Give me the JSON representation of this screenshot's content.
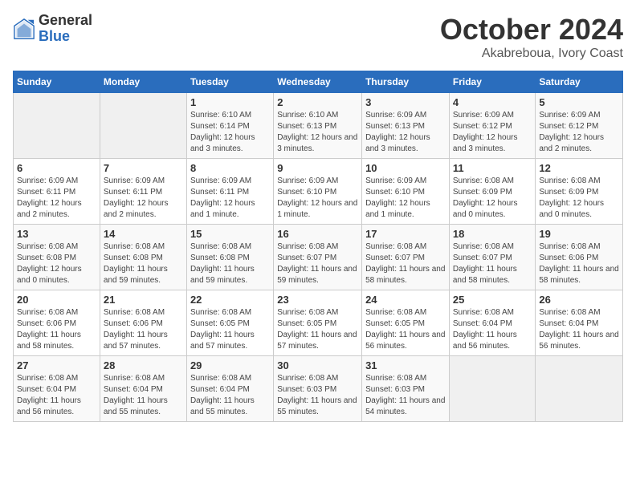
{
  "header": {
    "logo_general": "General",
    "logo_blue": "Blue",
    "month": "October 2024",
    "location": "Akabreboua, Ivory Coast"
  },
  "weekdays": [
    "Sunday",
    "Monday",
    "Tuesday",
    "Wednesday",
    "Thursday",
    "Friday",
    "Saturday"
  ],
  "weeks": [
    [
      {
        "day": "",
        "info": ""
      },
      {
        "day": "",
        "info": ""
      },
      {
        "day": "1",
        "info": "Sunrise: 6:10 AM\nSunset: 6:14 PM\nDaylight: 12 hours and 3 minutes."
      },
      {
        "day": "2",
        "info": "Sunrise: 6:10 AM\nSunset: 6:13 PM\nDaylight: 12 hours and 3 minutes."
      },
      {
        "day": "3",
        "info": "Sunrise: 6:09 AM\nSunset: 6:13 PM\nDaylight: 12 hours and 3 minutes."
      },
      {
        "day": "4",
        "info": "Sunrise: 6:09 AM\nSunset: 6:12 PM\nDaylight: 12 hours and 3 minutes."
      },
      {
        "day": "5",
        "info": "Sunrise: 6:09 AM\nSunset: 6:12 PM\nDaylight: 12 hours and 2 minutes."
      }
    ],
    [
      {
        "day": "6",
        "info": "Sunrise: 6:09 AM\nSunset: 6:11 PM\nDaylight: 12 hours and 2 minutes."
      },
      {
        "day": "7",
        "info": "Sunrise: 6:09 AM\nSunset: 6:11 PM\nDaylight: 12 hours and 2 minutes."
      },
      {
        "day": "8",
        "info": "Sunrise: 6:09 AM\nSunset: 6:11 PM\nDaylight: 12 hours and 1 minute."
      },
      {
        "day": "9",
        "info": "Sunrise: 6:09 AM\nSunset: 6:10 PM\nDaylight: 12 hours and 1 minute."
      },
      {
        "day": "10",
        "info": "Sunrise: 6:09 AM\nSunset: 6:10 PM\nDaylight: 12 hours and 1 minute."
      },
      {
        "day": "11",
        "info": "Sunrise: 6:08 AM\nSunset: 6:09 PM\nDaylight: 12 hours and 0 minutes."
      },
      {
        "day": "12",
        "info": "Sunrise: 6:08 AM\nSunset: 6:09 PM\nDaylight: 12 hours and 0 minutes."
      }
    ],
    [
      {
        "day": "13",
        "info": "Sunrise: 6:08 AM\nSunset: 6:08 PM\nDaylight: 12 hours and 0 minutes."
      },
      {
        "day": "14",
        "info": "Sunrise: 6:08 AM\nSunset: 6:08 PM\nDaylight: 11 hours and 59 minutes."
      },
      {
        "day": "15",
        "info": "Sunrise: 6:08 AM\nSunset: 6:08 PM\nDaylight: 11 hours and 59 minutes."
      },
      {
        "day": "16",
        "info": "Sunrise: 6:08 AM\nSunset: 6:07 PM\nDaylight: 11 hours and 59 minutes."
      },
      {
        "day": "17",
        "info": "Sunrise: 6:08 AM\nSunset: 6:07 PM\nDaylight: 11 hours and 58 minutes."
      },
      {
        "day": "18",
        "info": "Sunrise: 6:08 AM\nSunset: 6:07 PM\nDaylight: 11 hours and 58 minutes."
      },
      {
        "day": "19",
        "info": "Sunrise: 6:08 AM\nSunset: 6:06 PM\nDaylight: 11 hours and 58 minutes."
      }
    ],
    [
      {
        "day": "20",
        "info": "Sunrise: 6:08 AM\nSunset: 6:06 PM\nDaylight: 11 hours and 58 minutes."
      },
      {
        "day": "21",
        "info": "Sunrise: 6:08 AM\nSunset: 6:06 PM\nDaylight: 11 hours and 57 minutes."
      },
      {
        "day": "22",
        "info": "Sunrise: 6:08 AM\nSunset: 6:05 PM\nDaylight: 11 hours and 57 minutes."
      },
      {
        "day": "23",
        "info": "Sunrise: 6:08 AM\nSunset: 6:05 PM\nDaylight: 11 hours and 57 minutes."
      },
      {
        "day": "24",
        "info": "Sunrise: 6:08 AM\nSunset: 6:05 PM\nDaylight: 11 hours and 56 minutes."
      },
      {
        "day": "25",
        "info": "Sunrise: 6:08 AM\nSunset: 6:04 PM\nDaylight: 11 hours and 56 minutes."
      },
      {
        "day": "26",
        "info": "Sunrise: 6:08 AM\nSunset: 6:04 PM\nDaylight: 11 hours and 56 minutes."
      }
    ],
    [
      {
        "day": "27",
        "info": "Sunrise: 6:08 AM\nSunset: 6:04 PM\nDaylight: 11 hours and 56 minutes."
      },
      {
        "day": "28",
        "info": "Sunrise: 6:08 AM\nSunset: 6:04 PM\nDaylight: 11 hours and 55 minutes."
      },
      {
        "day": "29",
        "info": "Sunrise: 6:08 AM\nSunset: 6:04 PM\nDaylight: 11 hours and 55 minutes."
      },
      {
        "day": "30",
        "info": "Sunrise: 6:08 AM\nSunset: 6:03 PM\nDaylight: 11 hours and 55 minutes."
      },
      {
        "day": "31",
        "info": "Sunrise: 6:08 AM\nSunset: 6:03 PM\nDaylight: 11 hours and 54 minutes."
      },
      {
        "day": "",
        "info": ""
      },
      {
        "day": "",
        "info": ""
      }
    ]
  ]
}
